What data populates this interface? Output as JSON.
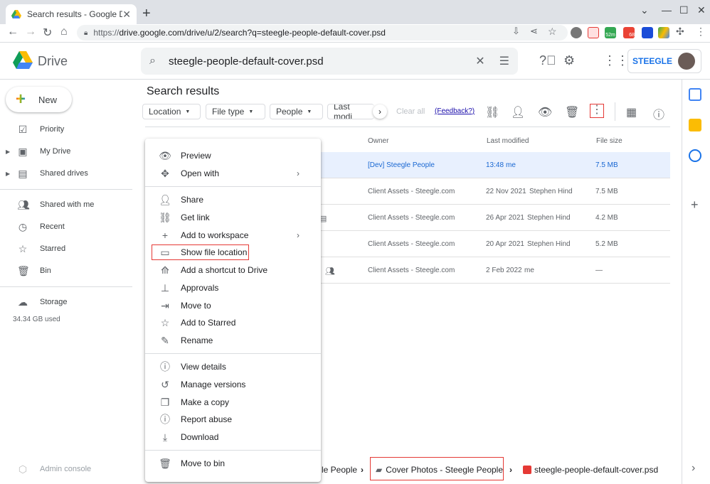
{
  "browser": {
    "tab_title": "Search results - Google Drive",
    "url_scheme": "https://",
    "url_rest": "drive.google.com/drive/u/2/search?q=steegle-people-default-cover.psd",
    "ext_badge_1": "52m",
    "ext_badge_2": "68"
  },
  "header": {
    "brand": "Drive",
    "search_query": "steegle-people-default-cover.psd",
    "org_logo": "STEEGLE"
  },
  "sidebar": {
    "new_label": "New",
    "items": [
      {
        "label": "Priority",
        "icon": "check-box-icon"
      },
      {
        "label": "My Drive",
        "icon": "drive-icon"
      },
      {
        "label": "Shared drives",
        "icon": "shared-drives-icon"
      },
      {
        "label": "Shared with me",
        "icon": "people-icon"
      },
      {
        "label": "Recent",
        "icon": "clock-icon"
      },
      {
        "label": "Starred",
        "icon": "star-icon"
      },
      {
        "label": "Bin",
        "icon": "trash-icon"
      },
      {
        "label": "Storage",
        "icon": "cloud-icon"
      }
    ],
    "storage_used": "34.34 GB used",
    "admin": "Admin console"
  },
  "main": {
    "title": "Search results",
    "filters": [
      "Location",
      "File type",
      "People",
      "Last modi"
    ],
    "clear_all": "Clear all",
    "feedback": "(Feedback?)",
    "columns": {
      "owner": "Owner",
      "modified": "Last modified",
      "size": "File size"
    },
    "rows": [
      {
        "owner": "[Dev] Steegle People",
        "modified": "13:48",
        "modified_by": "me",
        "size": "7.5 MB"
      },
      {
        "owner": "Client Assets - Steegle.com",
        "modified": "22 Nov 2021",
        "modified_by": "Stephen Hind",
        "size": "7.5 MB"
      },
      {
        "owner": "Client Assets - Steegle.com",
        "modified": "26 Apr 2021",
        "modified_by": "Stephen Hind",
        "size": "4.2 MB"
      },
      {
        "owner": "Client Assets - Steegle.com",
        "modified": "20 Apr 2021",
        "modified_by": "Stephen Hind",
        "size": "5.2 MB"
      },
      {
        "owner": "Client Assets - Steegle.com",
        "modified": "2 Feb 2022",
        "modified_by": "me",
        "size": "—"
      }
    ]
  },
  "menu": {
    "items": [
      "Preview",
      "Open with",
      "Share",
      "Get link",
      "Add to workspace",
      "Show file location",
      "Add a shortcut to Drive",
      "Approvals",
      "Move to",
      "Add to Starred",
      "Rename",
      "View details",
      "Manage versions",
      "Make a copy",
      "Report abuse",
      "Download",
      "Move to bin"
    ]
  },
  "breadcrumb": {
    "parent_tail": "le People",
    "folder": "Cover Photos - Steegle People",
    "file": "steegle-people-default-cover.psd"
  }
}
